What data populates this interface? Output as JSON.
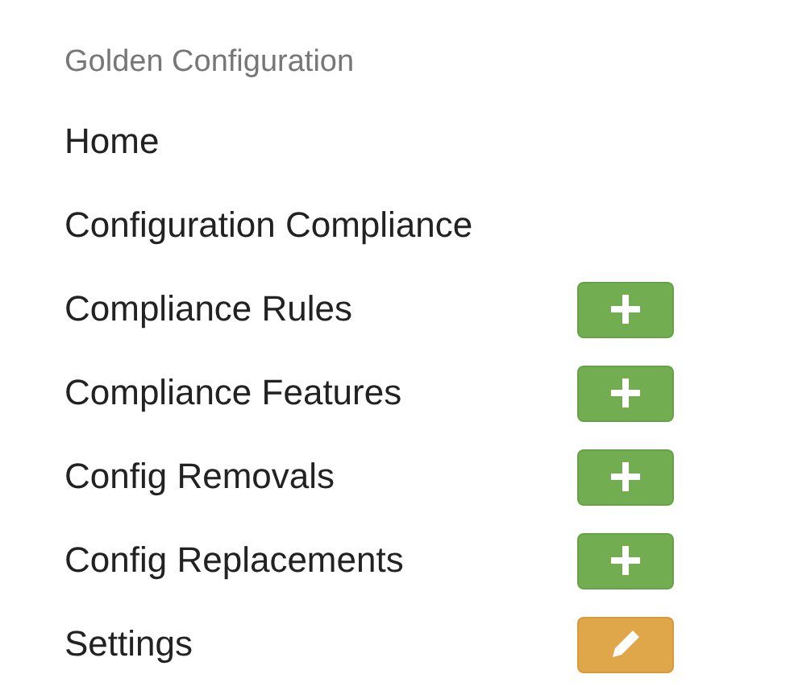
{
  "menu": {
    "heading": "Golden Configuration",
    "items": [
      {
        "label": "Home",
        "kind": "plain"
      },
      {
        "label": "Configuration Compliance",
        "kind": "plain"
      },
      {
        "label": "Compliance Rules",
        "kind": "add"
      },
      {
        "label": "Compliance Features",
        "kind": "add"
      },
      {
        "label": "Config Removals",
        "kind": "add"
      },
      {
        "label": "Config Replacements",
        "kind": "add"
      },
      {
        "label": "Settings",
        "kind": "edit"
      }
    ]
  }
}
